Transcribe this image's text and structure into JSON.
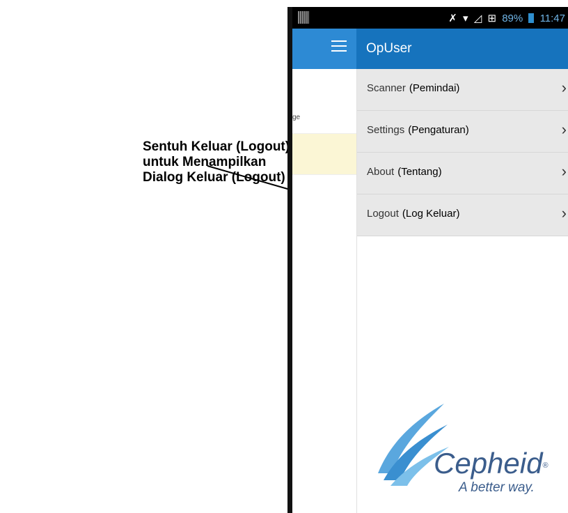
{
  "callout": {
    "line1": "Sentuh Keluar (Logout)",
    "line2": "untuk Menampilkan",
    "line3": "Dialog Keluar (Logout)"
  },
  "statusbar": {
    "battery_pct": "89%",
    "time": "11:47",
    "icons": [
      "mute-icon",
      "wifi-icon",
      "signal-icon",
      "network-icon",
      "battery-icon"
    ]
  },
  "appbar": {
    "title": "OpUser",
    "menu_icon": "hamburger-icon",
    "color": "#1673bd"
  },
  "background_page": {
    "fragment_text": "ge"
  },
  "drawer": {
    "items": [
      {
        "label": "Scanner",
        "translation": "(Pemindai)"
      },
      {
        "label": "Settings",
        "translation": "(Pengaturan)"
      },
      {
        "label": "About",
        "translation": "(Tentang)"
      },
      {
        "label": "Logout",
        "translation": "(Log Keluar)"
      }
    ]
  },
  "logo": {
    "name": "Cepheid",
    "registered": "®",
    "tagline": "A better way.",
    "color": "#3b5d8c"
  }
}
